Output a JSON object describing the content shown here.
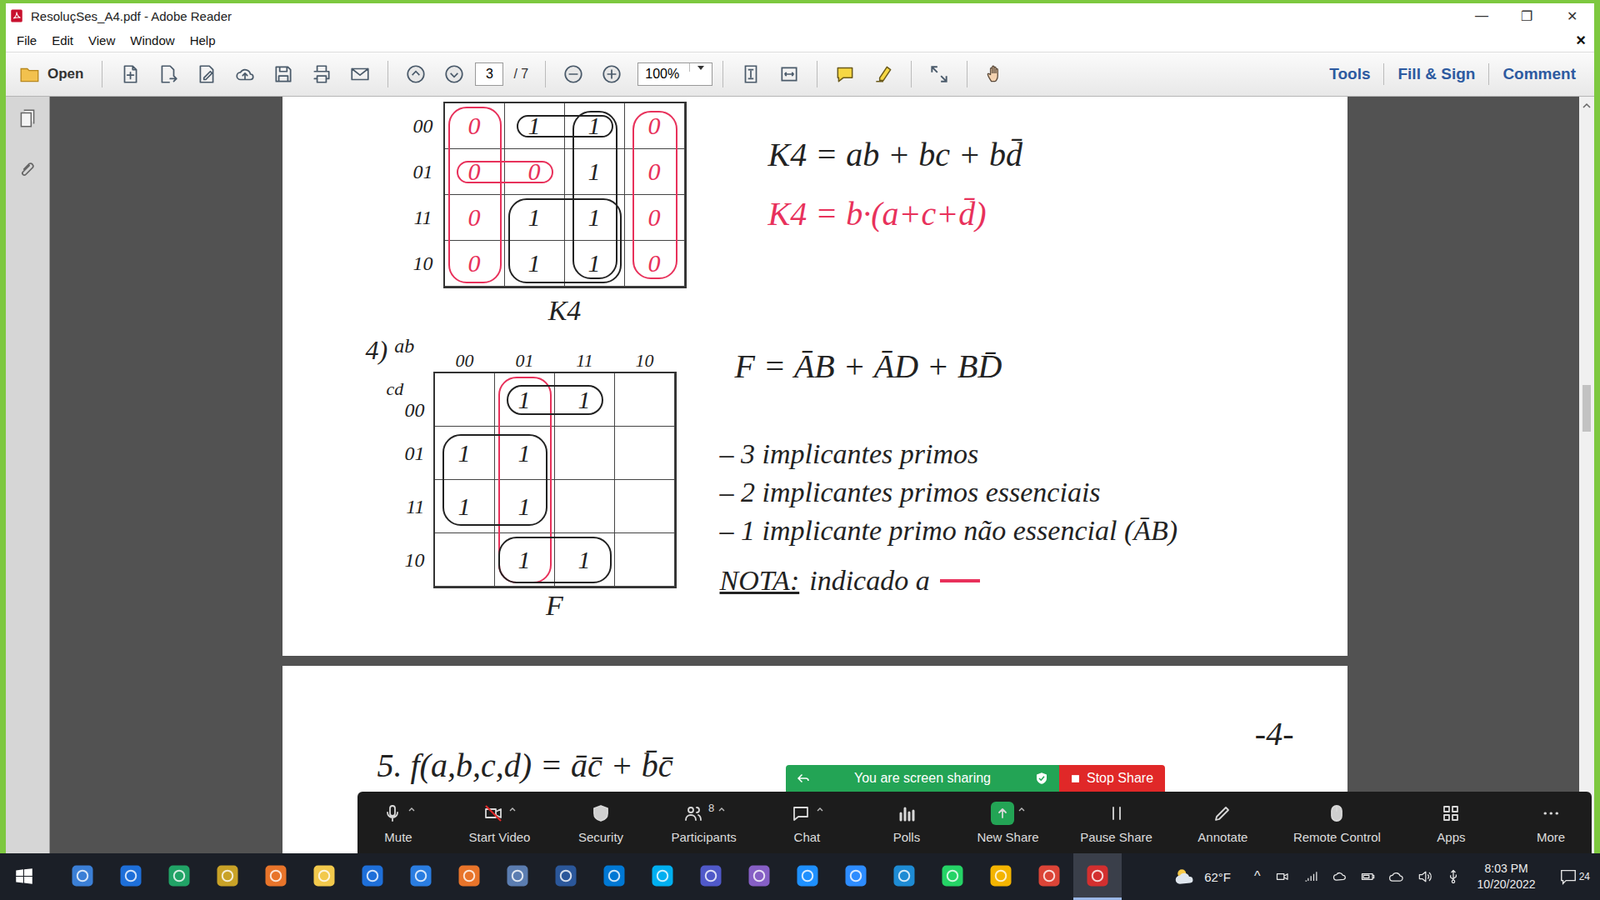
{
  "window": {
    "title": "ResoluçSes_A4.pdf - Adobe Reader",
    "controls": [
      "—",
      "❐",
      "✕"
    ]
  },
  "menu": {
    "items": [
      "File",
      "Edit",
      "View",
      "Window",
      "Help"
    ],
    "close": "×"
  },
  "toolbar": {
    "open": "Open",
    "page": "3",
    "page_count": "/ 7",
    "zoom": "100%",
    "actions": [
      "Tools",
      "Fill & Sign",
      "Comment"
    ]
  },
  "document": {
    "k4": {
      "rows": [
        "00",
        "01",
        "11",
        "10"
      ],
      "cells": [
        [
          "0",
          "1",
          "1",
          "0"
        ],
        [
          "0",
          "0",
          "1",
          "0"
        ],
        [
          "0",
          "1",
          "1",
          "0"
        ],
        [
          "0",
          "1",
          "1",
          "0"
        ]
      ],
      "cell_colors": {
        "0": "#e8315b",
        "1": "#222222"
      },
      "groups": [
        {
          "rows": [
            0,
            3
          ],
          "cols": [
            0,
            0
          ],
          "color": "#e8315b"
        },
        {
          "rows": [
            0,
            3
          ],
          "cols": [
            3,
            3
          ],
          "color": "#e8315b"
        },
        {
          "rows": [
            1,
            1
          ],
          "cols": [
            0,
            1
          ],
          "color": "#e8315b"
        },
        {
          "rows": [
            2,
            3
          ],
          "cols": [
            1,
            2
          ],
          "color": "#222222"
        },
        {
          "rows": [
            0,
            3
          ],
          "cols": [
            2,
            2
          ],
          "color": "#222222"
        },
        {
          "rows": [
            0,
            0
          ],
          "cols": [
            1,
            2
          ],
          "color": "#222222"
        }
      ],
      "label": "K4",
      "equations": [
        {
          "text": "K4 = ab + bc + bd̄",
          "color": "#222222"
        },
        {
          "text": "K4 = b·(a+c+d̄)",
          "color": "#e8315b"
        }
      ]
    },
    "f": {
      "number": "4)",
      "ab": "ab",
      "cd": "cd",
      "cols": [
        "00",
        "01",
        "11",
        "10"
      ],
      "rows": [
        "00",
        "01",
        "11",
        "10"
      ],
      "cells": [
        [
          "",
          "1",
          "1",
          ""
        ],
        [
          "1",
          "1",
          "",
          ""
        ],
        [
          "1",
          "1",
          "",
          ""
        ],
        [
          "",
          "1",
          "1",
          ""
        ]
      ],
      "cell_colors": {
        "1": "#222222"
      },
      "groups": [
        {
          "rows": [
            0,
            3
          ],
          "cols": [
            1,
            1
          ],
          "color": "#e8315b"
        },
        {
          "rows": [
            1,
            2
          ],
          "cols": [
            0,
            1
          ],
          "color": "#222222"
        },
        {
          "rows": [
            0,
            0
          ],
          "cols": [
            1,
            2
          ],
          "color": "#222222"
        },
        {
          "rows": [
            3,
            3
          ],
          "cols": [
            1,
            2
          ],
          "color": "#222222"
        }
      ],
      "label": "F",
      "equation": "F = ĀB + ĀD + BD̄",
      "notes": [
        "– 3 implicantes primos",
        "– 2 implicantes primos essenciais",
        "– 1 implicante primo não essencial (ĀB)"
      ],
      "nota": {
        "label": "NOTA:",
        "text": "indicado a",
        "color": "#e8315b"
      }
    },
    "next_page": {
      "page_number": "-4-",
      "problem": "5. f(a,b,c,d) = āc̄ + b̄c̄"
    }
  },
  "zoom": {
    "sharing": "You are screen sharing",
    "stop": "Stop Share",
    "buttons": [
      {
        "label": "Mute",
        "menu": true
      },
      {
        "label": "Start Video",
        "menu": true
      },
      {
        "label": "Security",
        "menu": false
      },
      {
        "label": "Participants",
        "count": "8",
        "menu": true
      },
      {
        "label": "Chat",
        "menu": true
      },
      {
        "label": "Polls",
        "menu": false
      },
      {
        "label": "New Share",
        "menu": true
      },
      {
        "label": "Pause Share",
        "menu": false
      },
      {
        "label": "Annotate",
        "menu": false
      },
      {
        "label": "Remote Control",
        "menu": false
      },
      {
        "label": "Apps",
        "menu": false
      },
      {
        "label": "More",
        "menu": false
      }
    ]
  },
  "taskbar": {
    "apps": [
      {
        "color": "#3b7fd6",
        "active": false
      },
      {
        "color": "#1e6fd9",
        "active": false
      },
      {
        "color": "#21a366",
        "active": false
      },
      {
        "color": "#c9a227",
        "active": false
      },
      {
        "color": "#e8742a",
        "active": false
      },
      {
        "color": "#f2c94c",
        "active": false
      },
      {
        "color": "#1e6fd9",
        "active": false
      },
      {
        "color": "#2a7de1",
        "active": false
      },
      {
        "color": "#e8742a",
        "active": false
      },
      {
        "color": "#5b7db1",
        "active": false
      },
      {
        "color": "#2b579a",
        "active": false
      },
      {
        "color": "#0078d4",
        "active": false
      },
      {
        "color": "#00aff0",
        "active": false
      },
      {
        "color": "#5059c9",
        "active": false
      },
      {
        "color": "#865fc5",
        "active": false
      },
      {
        "color": "#1e90ff",
        "active": false
      },
      {
        "color": "#2d8cff",
        "active": false
      },
      {
        "color": "#1e8bd4",
        "active": false
      },
      {
        "color": "#25d366",
        "active": false
      },
      {
        "color": "#f4b400",
        "active": false
      },
      {
        "color": "#db4437",
        "active": false
      },
      {
        "color": "#d32f2f",
        "active": true
      }
    ],
    "weather": "62°F",
    "tray_chevron": "^",
    "time": "8:03 PM",
    "date": "10/20/2022",
    "notifications": "24"
  }
}
